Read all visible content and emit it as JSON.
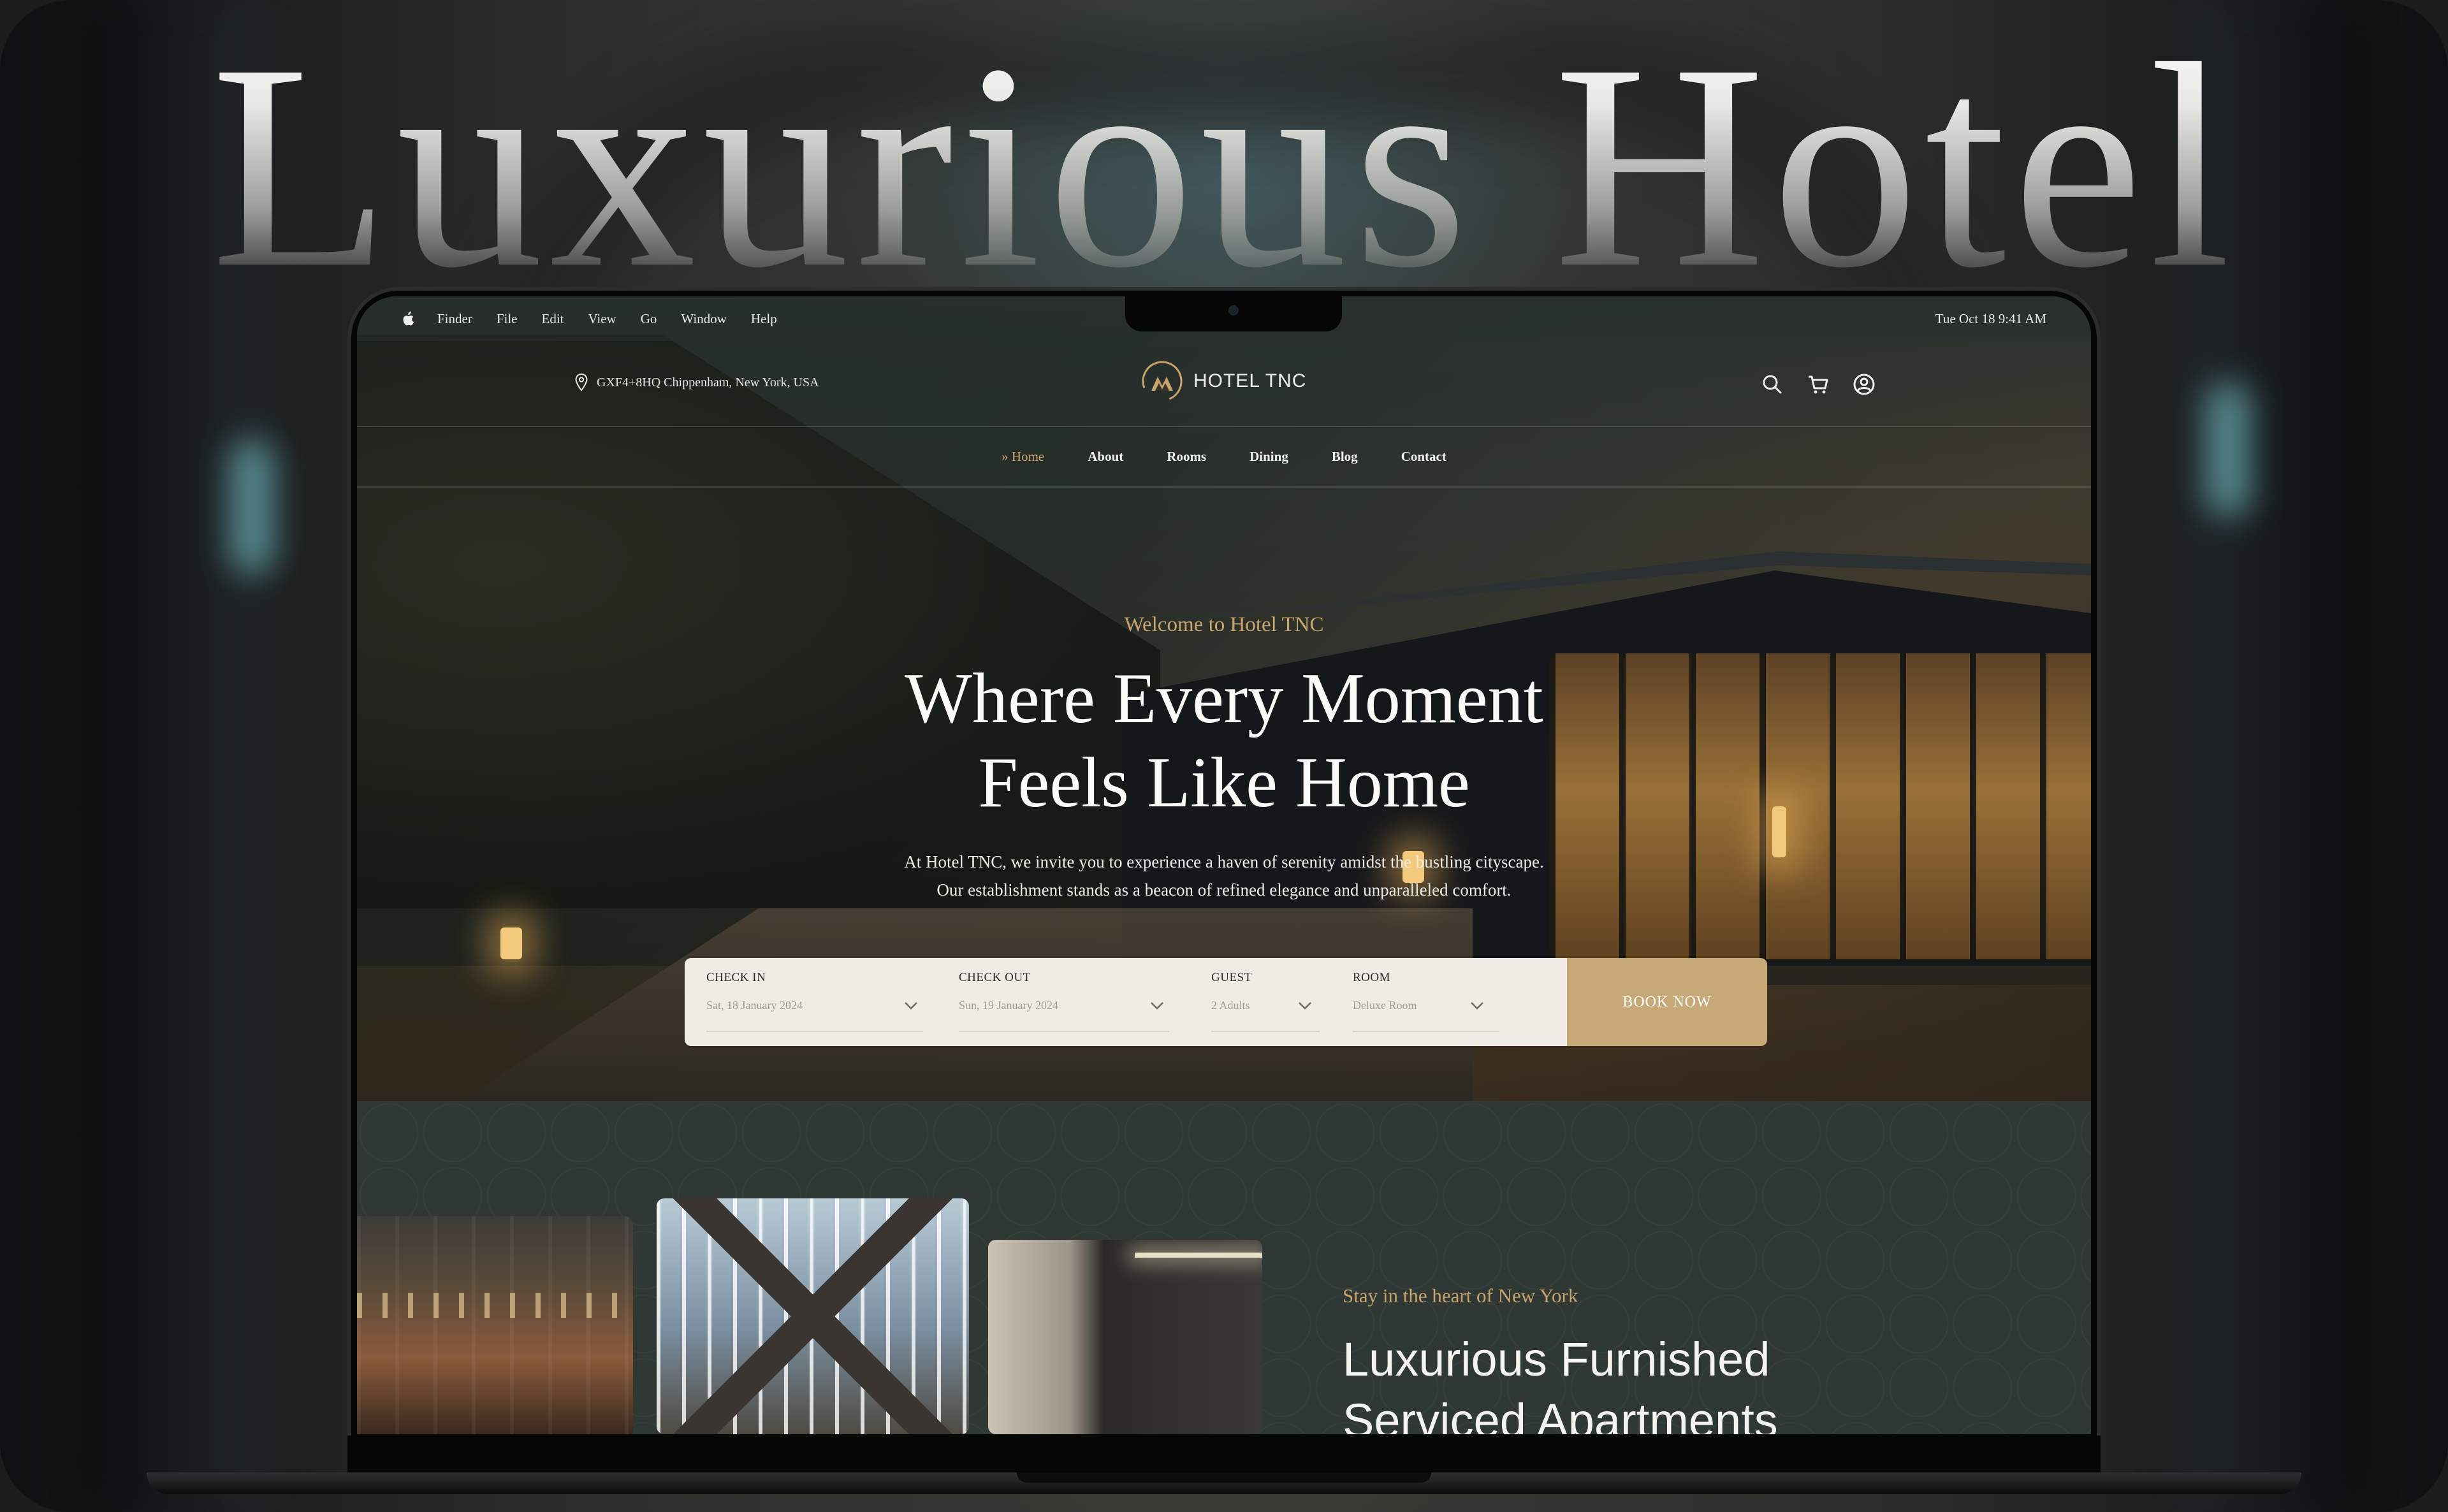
{
  "showcase": {
    "title": "Luxurious Hotel"
  },
  "menubar": {
    "items": [
      "Finder",
      "File",
      "Edit",
      "View",
      "Go",
      "Window",
      "Help"
    ],
    "clock": "Tue Oct 18  9:41 AM"
  },
  "header": {
    "address": "GXF4+8HQ Chippenham, New York, USA",
    "brand": "HOTEL TNC",
    "icons": [
      "search-icon",
      "cart-icon",
      "user-icon"
    ]
  },
  "nav": {
    "active_prefix": "»",
    "items": [
      {
        "label": "Home",
        "active": true
      },
      {
        "label": "About",
        "active": false
      },
      {
        "label": "Rooms",
        "active": false
      },
      {
        "label": "Dining",
        "active": false
      },
      {
        "label": "Blog",
        "active": false
      },
      {
        "label": "Contact",
        "active": false
      }
    ]
  },
  "hero": {
    "welcome": "Welcome to Hotel TNC",
    "headline_line1": "Where Every Moment",
    "headline_line2": "Feels Like Home",
    "intro_line1": "At Hotel TNC, we invite you to experience a haven of serenity amidst the bustling cityscape.",
    "intro_line2": "Our establishment stands as a beacon of refined elegance and unparalleled comfort."
  },
  "booking": {
    "check_in": {
      "label": "CHECK IN",
      "value": "Sat, 18 January 2024"
    },
    "check_out": {
      "label": "CHECK OUT",
      "value": "Sun, 19 January 2024"
    },
    "guest": {
      "label": "GUEST",
      "value": "2 Adults"
    },
    "room": {
      "label": "ROOM",
      "value": "Deluxe Room"
    },
    "button": "BOOK NOW"
  },
  "section": {
    "eyebrow": "Stay in the heart of New York",
    "title_line1": "Luxurious Furnished",
    "title_line2": "Serviced Apartments"
  },
  "colors": {
    "accent_gold": "#c9a46b",
    "button_gold": "#c7a877",
    "page_green": "#2f3835",
    "booking_bg": "#efece6"
  }
}
